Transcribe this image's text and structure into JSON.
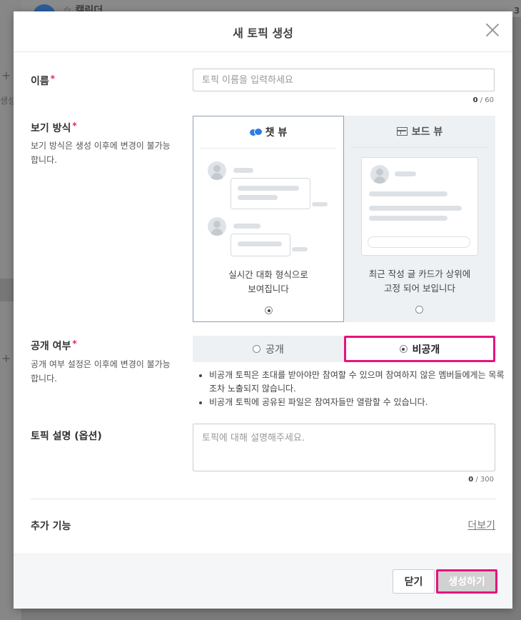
{
  "background": {
    "channel_title": "캘린더",
    "side_label": "생성",
    "count_fragment": "3"
  },
  "modal": {
    "title": "새 토픽 생성",
    "name": {
      "label": "이름",
      "required_mark": "*",
      "placeholder": "토픽 이름을 입력하세요",
      "count": "0",
      "max": "/ 60"
    },
    "view_mode": {
      "label": "보기 방식",
      "required_mark": "*",
      "note": "보기 방식은 생성 이후에 변경이 불가능합니다.",
      "options": [
        {
          "label": "챗 뷰",
          "icon": "chat-bubbles-icon",
          "desc_line1": "실시간 대화 형식으로",
          "desc_line2": "보여집니다",
          "selected": true
        },
        {
          "label": "보드 뷰",
          "icon": "board-icon",
          "desc_line1": "최근 작성 글 카드가 상위에",
          "desc_line2": "고정 되어 보입니다",
          "selected": false
        }
      ]
    },
    "visibility": {
      "label": "공개 여부",
      "required_mark": "*",
      "note": "공개 여부 설정은 이후에 변경이 불가능합니다.",
      "options": [
        {
          "label": "공개",
          "selected": false
        },
        {
          "label": "비공개",
          "selected": true
        }
      ],
      "notes": [
        "비공개 토픽은 초대를 받아야만 참여할 수 있으며 참여하지 않은 멤버들에게는 목록조차 노출되지 않습니다.",
        "비공개 토픽에 공유된 파일은 참여자들만 열람할 수 있습니다."
      ]
    },
    "description": {
      "label": "토픽 설명 (옵션)",
      "placeholder": "토픽에 대해 설명해주세요.",
      "count": "0",
      "max": "/ 300"
    },
    "extra": {
      "label": "추가 기능",
      "more_link": "더보기"
    },
    "footer": {
      "close_label": "닫기",
      "create_label": "생성하기"
    },
    "colors": {
      "highlight": "#e6137f",
      "chat_icon": "#2d7be5",
      "selected_border": "#8fa0b4"
    }
  }
}
